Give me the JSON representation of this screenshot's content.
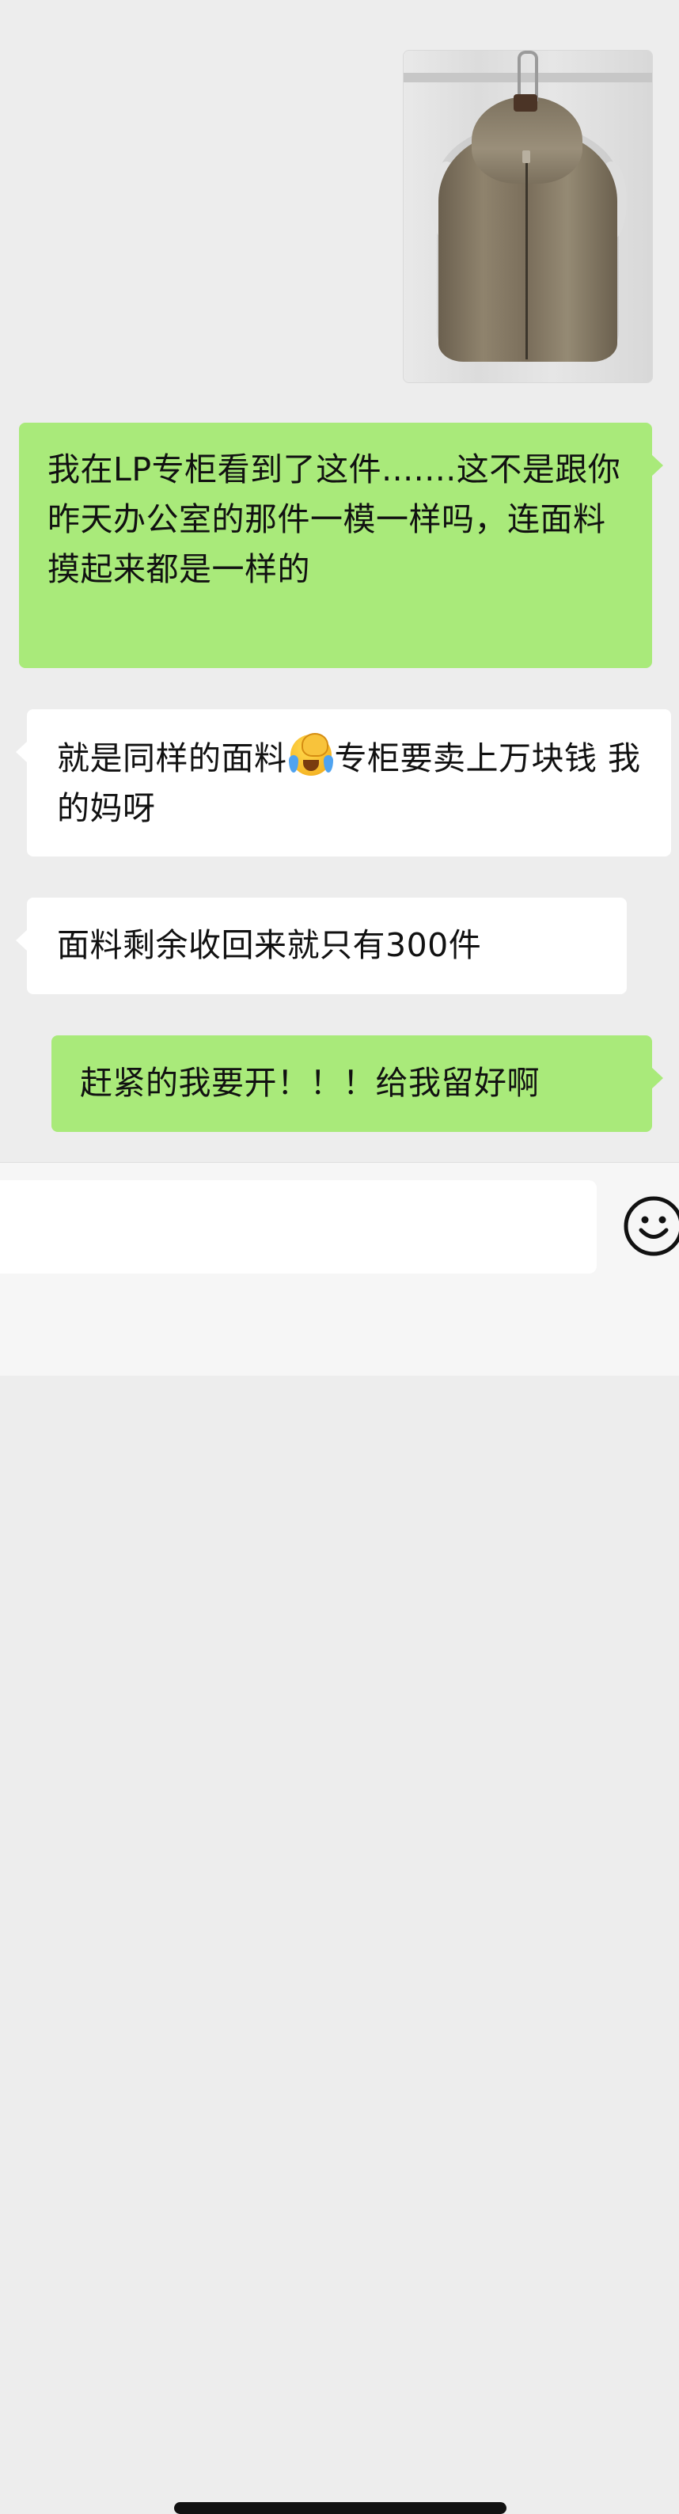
{
  "messages": [
    {
      "id": "msg0",
      "sender": "me",
      "type": "image"
    },
    {
      "id": "msg1",
      "sender": "me",
      "type": "text",
      "text": "我在LP专柜看到了这件.......这不是跟你昨天办公室的那件一模一样吗，连面料摸起来都是一样的"
    },
    {
      "id": "msg2",
      "sender": "them",
      "type": "text",
      "text_before_emoji": "就是同样的面料",
      "emoji": "crying-facepalm",
      "text_after_emoji": "专柜要卖上万块钱 我的妈呀"
    },
    {
      "id": "msg3",
      "sender": "them",
      "type": "text",
      "text": "面料剩余收回来就只有300件"
    },
    {
      "id": "msg4",
      "sender": "me",
      "type": "text",
      "text": "赶紧的我要开！！！给我留好啊"
    }
  ],
  "input_bar": {
    "placeholder": "",
    "emoji_icon": "smiley-face-icon"
  },
  "colors": {
    "background": "#ededed",
    "my_bubble": "#a9ea7a",
    "their_bubble": "#ffffff",
    "text": "#111111"
  }
}
